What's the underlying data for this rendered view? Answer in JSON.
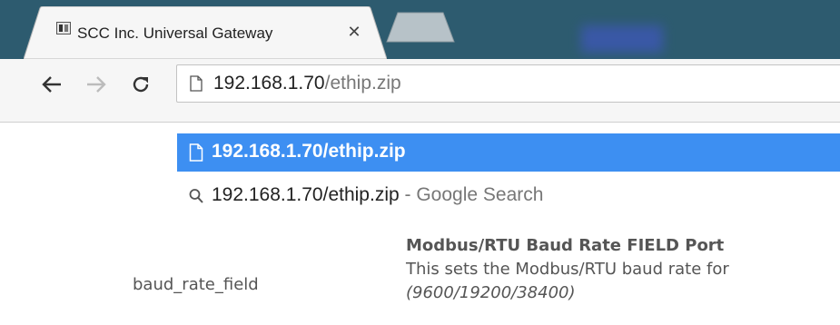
{
  "tab": {
    "title": "SCC Inc. Universal Gateway",
    "close": "✕"
  },
  "omnibox": {
    "host": "192.168.1.70",
    "path": "/ethip.zip"
  },
  "suggestions": [
    {
      "text": "192.168.1.70/ethip.zip",
      "icon": "page-icon"
    },
    {
      "text": "192.168.1.70/ethip.zip",
      "suffix": " - Google Search",
      "icon": "search-icon"
    }
  ],
  "content": {
    "field_name": "baud_rate_field",
    "heading": "Modbus/RTU Baud Rate FIELD Port",
    "description": "This sets the Modbus/RTU baud rate for",
    "note": "(9600/19200/38400)"
  },
  "colors": {
    "tabstrip": "#2d5b6f",
    "selection": "#3d8ff2",
    "toolbar": "#f6f6f6"
  }
}
